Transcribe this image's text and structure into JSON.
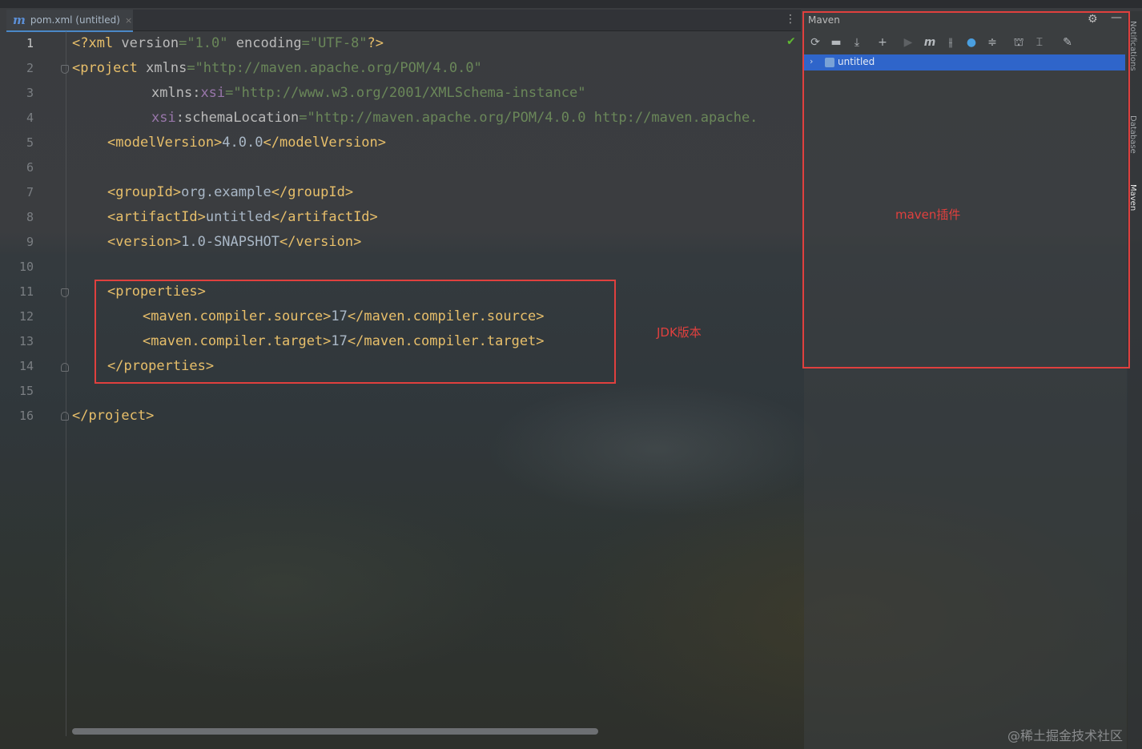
{
  "tab": {
    "icon": "m",
    "label": "pom.xml (untitled)",
    "close": "×"
  },
  "editor": {
    "line_numbers": [
      "1",
      "2",
      "3",
      "4",
      "5",
      "6",
      "7",
      "8",
      "9",
      "10",
      "11",
      "12",
      "13",
      "14",
      "15",
      "16"
    ],
    "lines": {
      "l1": {
        "a": "<?xml ",
        "b": "version",
        "c": "=",
        "d": "\"1.0\"",
        "e": " encoding",
        "f": "=",
        "g": "\"UTF-8\"",
        "h": "?>"
      },
      "l2": {
        "a": "<project ",
        "b": "xmlns",
        "c": "=",
        "d": "\"http://maven.apache.org/POM/4.0.0\""
      },
      "l3": {
        "a": "xmlns",
        "b": ":",
        "c": "xsi",
        "d": "=",
        "e": "\"http://www.w3.org/2001/XMLSchema-instance\""
      },
      "l4": {
        "a": "xsi",
        "b": ":schemaLocation",
        "c": "=",
        "d": "\"http://maven.apache.org/POM/4.0.0 http://maven.apache."
      },
      "l5": {
        "a": "<modelVersion>",
        "b": "4.0.0",
        "c": "</modelVersion>"
      },
      "l7": {
        "a": "<groupId>",
        "b": "org.example",
        "c": "</groupId>"
      },
      "l8": {
        "a": "<artifactId>",
        "b": "untitled",
        "c": "</artifactId>"
      },
      "l9": {
        "a": "<version>",
        "b": "1.0-SNAPSHOT",
        "c": "</version>"
      },
      "l11": {
        "a": "<properties>"
      },
      "l12": {
        "a": "<maven.compiler.source>",
        "b": "17",
        "c": "</maven.compiler.source>"
      },
      "l13": {
        "a": "<maven.compiler.target>",
        "b": "17",
        "c": "</maven.compiler.target>"
      },
      "l14": {
        "a": "</properties>"
      },
      "l16": {
        "a": "</project>"
      }
    }
  },
  "annotations": {
    "jdk_label": "JDK版本",
    "maven_label": "maven插件"
  },
  "maven": {
    "title": "Maven",
    "toolbar_icons": [
      "reload-icon",
      "add-folder-icon",
      "download-icon",
      "plus-icon",
      "run-icon",
      "maven-goal-icon",
      "toggle-offline-icon",
      "skip-tests-icon",
      "collapse-icon",
      "show-dependencies-icon",
      "collapse-all-icon",
      "settings-wrench-icon"
    ],
    "tree": {
      "root_label": "untitled"
    }
  },
  "right_strip": {
    "items": [
      "Notifications",
      "Database",
      "Maven"
    ]
  },
  "watermark": "@稀土掘金技术社区",
  "colors": {
    "tag": "#e8bf6a",
    "attr_value": "#6a8759",
    "namespace": "#9876aa",
    "annotation_red": "#e0403e",
    "selection_blue": "#2f65ca"
  }
}
